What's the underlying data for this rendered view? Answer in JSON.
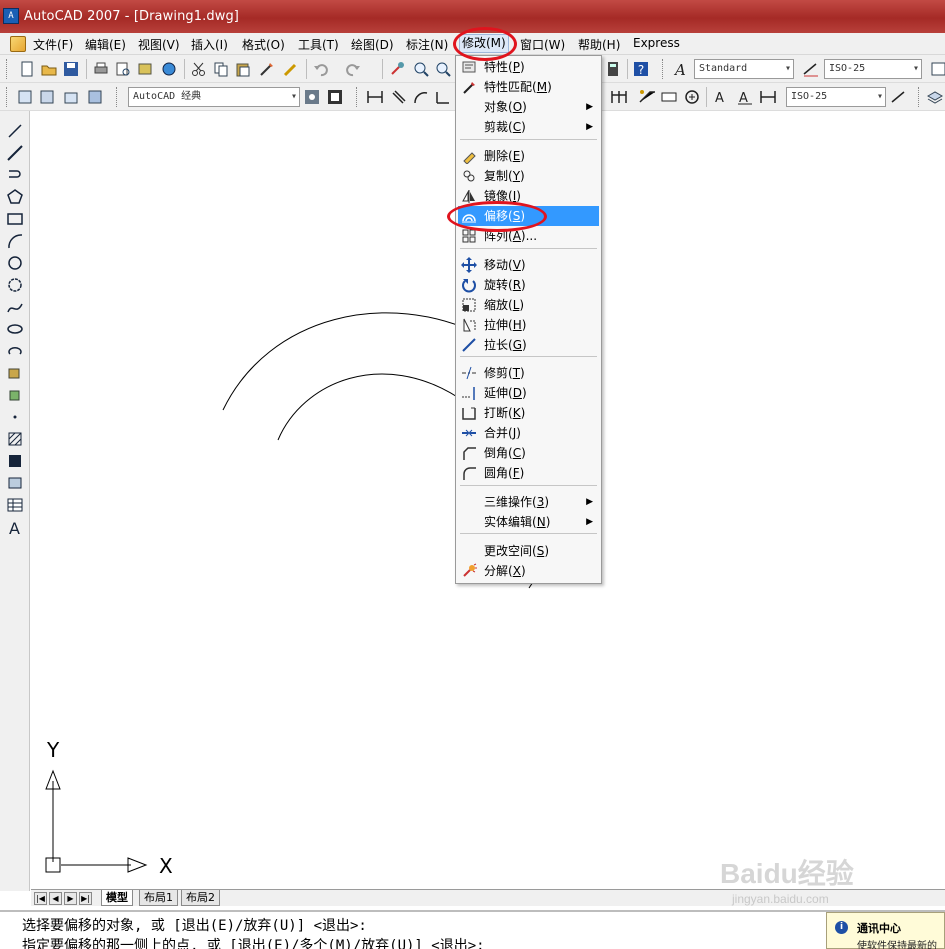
{
  "window": {
    "title": "AutoCAD 2007 - [Drawing1.dwg]",
    "app_icon": "autocad-icon"
  },
  "menubar": {
    "items": [
      {
        "label": "文件(F)"
      },
      {
        "label": "编辑(E)"
      },
      {
        "label": "视图(V)"
      },
      {
        "label": "插入(I)"
      },
      {
        "label": "格式(O)"
      },
      {
        "label": "工具(T)"
      },
      {
        "label": "绘图(D)"
      },
      {
        "label": "标注(N)"
      },
      {
        "label": "修改(M)"
      },
      {
        "label": "窗口(W)"
      },
      {
        "label": "帮助(H)"
      },
      {
        "label": "Express"
      }
    ],
    "active": "修改(M)"
  },
  "toolbar": {
    "text_style": "Standard",
    "dim_style": "ISO-25",
    "workspace": "AutoCAD 经典",
    "dim_style_2": "ISO-25"
  },
  "modify_menu": {
    "items": [
      {
        "label": "特性",
        "key": "P",
        "icon": "properties-icon"
      },
      {
        "label": "特性匹配",
        "key": "M",
        "icon": "match-properties-icon"
      },
      {
        "label": "对象",
        "key": "O",
        "submenu": true
      },
      {
        "label": "剪裁",
        "key": "C",
        "submenu": true
      },
      {
        "label": "删除",
        "key": "E",
        "icon": "erase-icon"
      },
      {
        "label": "复制",
        "key": "Y",
        "icon": "copy-icon"
      },
      {
        "label": "镜像",
        "key": "I",
        "icon": "mirror-icon"
      },
      {
        "label": "偏移",
        "key": "S",
        "icon": "offset-icon",
        "highlighted": true
      },
      {
        "label": "阵列",
        "key": "A",
        "icon": "array-icon",
        "suffix": "..."
      },
      {
        "label": "移动",
        "key": "V",
        "icon": "move-icon"
      },
      {
        "label": "旋转",
        "key": "R",
        "icon": "rotate-icon"
      },
      {
        "label": "缩放",
        "key": "L",
        "icon": "scale-icon"
      },
      {
        "label": "拉伸",
        "key": "H",
        "icon": "stretch-icon"
      },
      {
        "label": "拉长",
        "key": "G",
        "icon": "lengthen-icon"
      },
      {
        "label": "修剪",
        "key": "T",
        "icon": "trim-icon"
      },
      {
        "label": "延伸",
        "key": "D",
        "icon": "extend-icon"
      },
      {
        "label": "打断",
        "key": "K",
        "icon": "break-icon"
      },
      {
        "label": "合并",
        "key": "J",
        "icon": "join-icon"
      },
      {
        "label": "倒角",
        "key": "C",
        "icon": "chamfer-icon"
      },
      {
        "label": "圆角",
        "key": "F",
        "icon": "fillet-icon"
      },
      {
        "label": "三维操作",
        "key": "3",
        "submenu": true
      },
      {
        "label": "实体编辑",
        "key": "N",
        "submenu": true
      },
      {
        "label": "更改空间",
        "key": "S"
      },
      {
        "label": "分解",
        "key": "X",
        "icon": "explode-icon"
      }
    ]
  },
  "ucs": {
    "x_label": "X",
    "y_label": "Y"
  },
  "layout_tabs": {
    "model": "模型",
    "layout1": "布局1",
    "layout2": "布局2"
  },
  "command_line": {
    "line1": "选择要偏移的对象, 或 [退出(E)/放弃(U)] <退出>:",
    "line2": "指定要偏移的那一侧上的点, 或 [退出(E)/多个(M)/放弃(U)] <退出>:"
  },
  "comm_center": {
    "title": "通讯中心",
    "text": "使软件保持最新的"
  },
  "watermark": {
    "text": "Baidu经验",
    "sub": "jingyan.baidu.com"
  },
  "colors": {
    "highlight": "#3399ff",
    "annotation": "#e0141e",
    "titlebar": "#b0342f"
  }
}
